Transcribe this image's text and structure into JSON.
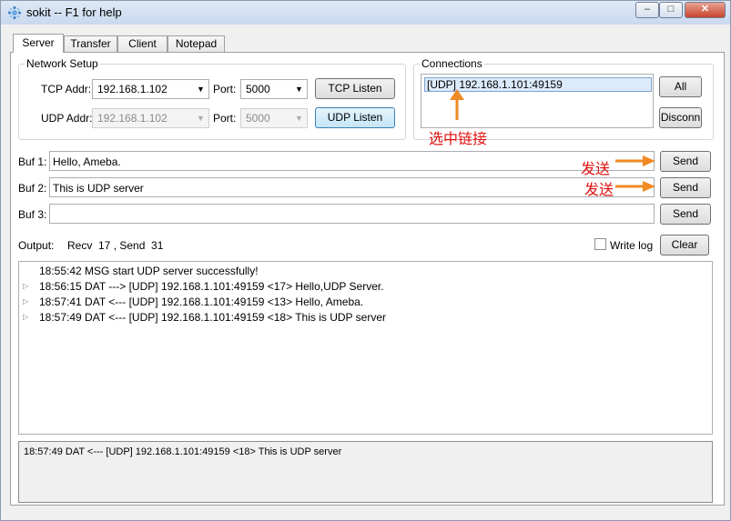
{
  "window": {
    "title": "sokit -- F1 for help",
    "controls": {
      "minimize": "–",
      "maximize": "□",
      "close": "✕"
    }
  },
  "tabs": [
    {
      "label": "Server",
      "active": true
    },
    {
      "label": "Transfer",
      "active": false
    },
    {
      "label": "Client",
      "active": false
    },
    {
      "label": "Notepad",
      "active": false
    }
  ],
  "network_setup": {
    "title": "Network Setup",
    "tcp_addr_label": "TCP Addr:",
    "tcp_addr_value": "192.168.1.102",
    "tcp_port_label": "Port:",
    "tcp_port_value": "5000",
    "tcp_listen_label": "TCP Listen",
    "udp_addr_label": "UDP Addr:",
    "udp_addr_value": "192.168.1.102",
    "udp_port_label": "Port:",
    "udp_port_value": "5000",
    "udp_listen_label": "UDP Listen"
  },
  "connections": {
    "title": "Connections",
    "items": [
      "[UDP] 192.168.1.101:49159"
    ],
    "all_label": "All",
    "disconn_label": "Disconn",
    "annotation": "选中链接"
  },
  "buffers": [
    {
      "label": "Buf 1:",
      "value": "Hello, Ameba.",
      "send_label": "Send",
      "annotation": "发送"
    },
    {
      "label": "Buf 2:",
      "value": "This is UDP server",
      "send_label": "Send",
      "annotation": "发送"
    },
    {
      "label": "Buf 3:",
      "value": "",
      "send_label": "Send",
      "annotation": ""
    }
  ],
  "output": {
    "label": "Output:",
    "stats": "Recv  17 , Send  31",
    "write_log_label": "Write log",
    "write_log_checked": false,
    "clear_label": "Clear",
    "log": [
      {
        "expandable": false,
        "text": "18:55:42 MSG start UDP server successfully!"
      },
      {
        "expandable": true,
        "text": "18:56:15 DAT ---> [UDP] 192.168.1.101:49159 <17> Hello,UDP Server."
      },
      {
        "expandable": true,
        "text": "18:57:41 DAT <--- [UDP] 192.168.1.101:49159 <13> Hello, Ameba."
      },
      {
        "expandable": true,
        "text": "18:57:49 DAT <--- [UDP] 192.168.1.101:49159 <18> This is UDP server"
      }
    ],
    "detail": "18:57:49 DAT <--- [UDP]  192.168.1.101:49159 <18> This is UDP server"
  },
  "colors": {
    "annotation": "#e01010",
    "arrow": "#f08a24",
    "selection": "#dcebfc"
  }
}
